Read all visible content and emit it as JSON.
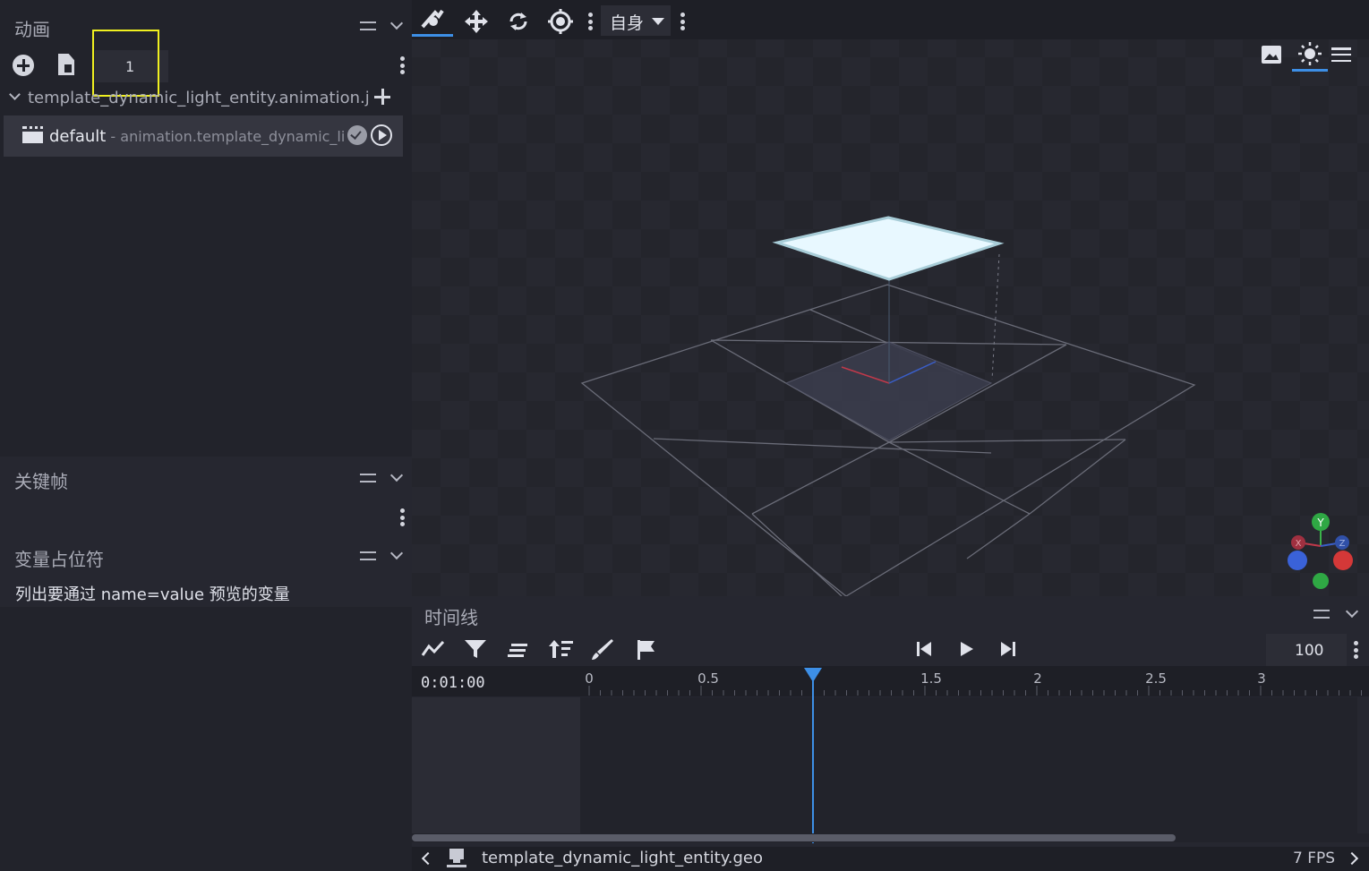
{
  "animation_panel": {
    "title": "动画",
    "frame_input_value": "1",
    "file_name": "template_dynamic_light_entity.animation.json",
    "anim_name": "default",
    "anim_id": " - animation.template_dynamic_light_entity.default"
  },
  "keyframe_panel": {
    "title": "关键帧"
  },
  "variables_panel": {
    "title": "变量占位符",
    "description": "列出要通过 name=value 预览的变量"
  },
  "viewport_toolbar": {
    "space_label": "自身"
  },
  "timeline": {
    "title": "时间线",
    "time_display": "0:01:00",
    "speed_value": "100",
    "ticks": [
      "0",
      "0.5",
      "1.5",
      "2",
      "2.5",
      "3"
    ],
    "playhead_seconds": 1
  },
  "statusbar": {
    "model_name": "template_dynamic_light_entity.geo",
    "fps": "7 FPS"
  },
  "axis_gizmo": {
    "y_label": "Y",
    "x_label": "X",
    "z_label": "Z"
  },
  "colors": {
    "accent": "#3d8fe6",
    "highlight_box": "#f0f020",
    "light_plane": "#e8f8ff"
  }
}
